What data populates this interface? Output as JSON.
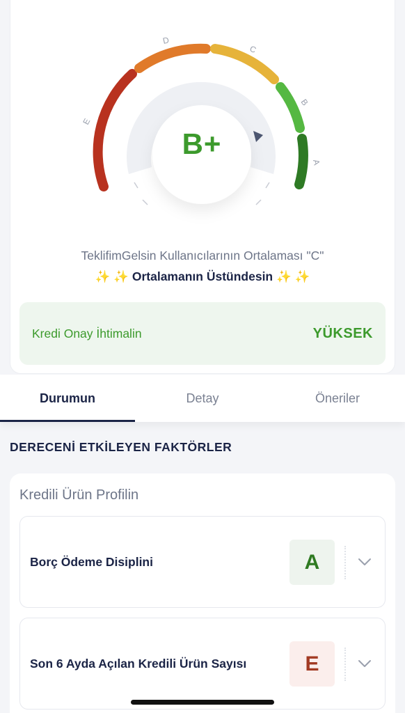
{
  "gauge": {
    "grade": "B+",
    "segments": [
      {
        "letter": "E",
        "color": "#b8321f"
      },
      {
        "letter": "D",
        "color": "#e07a2a"
      },
      {
        "letter": "C",
        "color": "#e6b33a"
      },
      {
        "letter": "B",
        "color": "#55b842"
      },
      {
        "letter": "A",
        "color": "#2e7a24"
      }
    ]
  },
  "summary": {
    "average_text": "TeklifimGelsin Kullanıcılarının Ortalaması \"C\"",
    "sparkles": "✨ ✨",
    "above_text": "Ortalamanın Üstündesin",
    "sparkles_after": "✨ ✨"
  },
  "approval": {
    "label": "Kredi Onay İhtimalin",
    "value": "YÜKSEK"
  },
  "tabs": [
    {
      "label": "Durumun",
      "active": true
    },
    {
      "label": "Detay",
      "active": false
    },
    {
      "label": "Öneriler",
      "active": false
    }
  ],
  "factors": {
    "section_title": "DERECENİ ETKİLEYEN FAKTÖRLER",
    "card_title": "Kredili Ürün Profilin",
    "items": [
      {
        "label": "Borç Ödeme Disiplini",
        "grade": "A"
      },
      {
        "label": "Son 6 Ayda Açılan Kredili Ürün Sayısı",
        "grade": "E"
      }
    ]
  },
  "colors": {
    "primary_text": "#1b2446",
    "success": "#3c9a2c",
    "tab_indicator": "#1b2446"
  },
  "icons": {
    "pointer": "triangle-pointer-icon",
    "expand": "chevron-down-icon"
  }
}
